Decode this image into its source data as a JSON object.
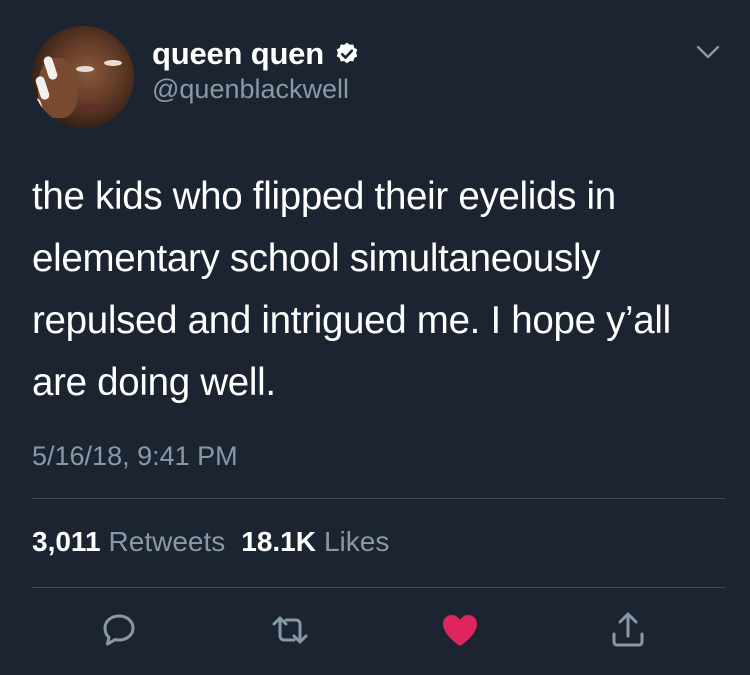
{
  "user": {
    "display_name": "queen quen",
    "handle": "@quenblackwell",
    "verified": true,
    "avatar": "profile-photo"
  },
  "tweet": {
    "text": "the kids who flipped their eyelids in elementary school simultaneously repulsed and intrigued me. I hope y’all are doing well.",
    "timestamp": "5/16/18, 9:41 PM"
  },
  "stats": {
    "retweets_count": "3,011",
    "retweets_label": "Retweets",
    "likes_count": "18.1K",
    "likes_label": "Likes"
  },
  "actions": [
    {
      "name": "reply",
      "icon": "speech-bubble-icon"
    },
    {
      "name": "retweet",
      "icon": "retweet-arrows-icon"
    },
    {
      "name": "like",
      "icon": "heart-icon",
      "active": true
    },
    {
      "name": "share",
      "icon": "share-upload-icon"
    }
  ],
  "colors": {
    "background": "#1c2431",
    "secondary_text": "#8899a6",
    "divider": "#3d4a5a",
    "like_active": "#e0245e",
    "verified_badge": "#ffffff"
  }
}
